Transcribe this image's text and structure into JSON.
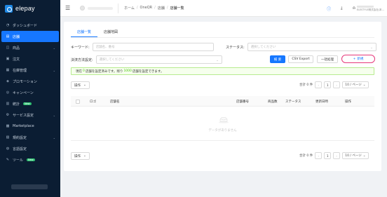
{
  "app": {
    "logo_text": "elepay"
  },
  "sidebar": {
    "items": [
      {
        "label": "ダッシュボード",
        "icon": "dashboard-icon",
        "glyph": "◔",
        "active": false,
        "chevron": false
      },
      {
        "label": "店舗",
        "icon": "store-icon",
        "glyph": "▤",
        "active": true,
        "chevron": false
      },
      {
        "label": "商品",
        "icon": "product-icon",
        "glyph": "◫",
        "active": false,
        "chevron": true
      },
      {
        "label": "注文",
        "icon": "order-icon",
        "glyph": "▣",
        "active": false,
        "chevron": false
      },
      {
        "label": "在庫管理",
        "icon": "inventory-icon",
        "glyph": "▦",
        "active": false,
        "chevron": true
      },
      {
        "label": "プロモーション",
        "icon": "promotion-icon",
        "glyph": "◈",
        "active": false,
        "chevron": false
      },
      {
        "label": "キャンペーン",
        "icon": "campaign-icon",
        "glyph": "◎",
        "active": false,
        "chevron": false
      },
      {
        "label": "統計",
        "icon": "stats-icon",
        "glyph": "▥",
        "active": false,
        "chevron": false,
        "badge": "New"
      },
      {
        "label": "サービス設定",
        "icon": "service-settings-icon",
        "glyph": "⚙",
        "active": false,
        "chevron": true
      },
      {
        "label": "Marketplace",
        "icon": "marketplace-icon",
        "glyph": "▩",
        "active": false,
        "chevron": false
      },
      {
        "label": "規約設定",
        "icon": "terms-icon",
        "glyph": "▧",
        "active": false,
        "chevron": true
      },
      {
        "label": "言語設定",
        "icon": "language-icon",
        "glyph": "◍",
        "active": false,
        "chevron": false
      },
      {
        "label": "ツール",
        "icon": "tool-icon",
        "glyph": "✎",
        "active": false,
        "chevron": false,
        "badge": "New"
      }
    ]
  },
  "header": {
    "breadcrumb": [
      "ホーム",
      "OneQR",
      "店舗",
      "店舗一覧"
    ],
    "user_company": "ELESTYLE株式会社(本..."
  },
  "tabs": [
    {
      "label": "店舗一覧",
      "active": true
    },
    {
      "label": "店舗地図",
      "active": false
    }
  ],
  "filters": {
    "keyword_label": "キーワード:",
    "keyword_placeholder": "店舗名、番号",
    "status_label": "ステータス:",
    "status_placeholder": "選択してください",
    "payment_label": "決済方法設定:",
    "payment_placeholder": "選択してください"
  },
  "actions": {
    "search": "検 索",
    "csv_export": "CSV Export",
    "bulk_process": "一括処理",
    "new": "新規"
  },
  "notice": {
    "prefix": "現在",
    "current": "0",
    "mid": "店舗を設定済みです。残り",
    "remaining": "1000",
    "suffix": "店舗を設定できます。"
  },
  "toolbar": {
    "ops_label": "操作",
    "total_text": "合計 0 件",
    "page": "1",
    "page_size": "10 / ページ"
  },
  "table": {
    "columns": [
      "ロゴ",
      "店舗名",
      "店舗番号",
      "商品数",
      "ステータス",
      "更新日時",
      "操作"
    ],
    "empty_text": "データがありません"
  },
  "colors": {
    "sidebar_bg": "#0b1d33",
    "primary": "#1677ff",
    "new_outline": "#e6387a",
    "notice_bg": "#f6ffed"
  }
}
